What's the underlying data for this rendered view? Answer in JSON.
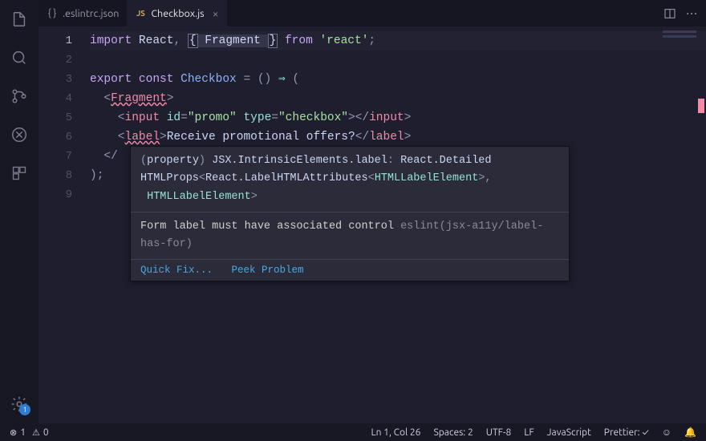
{
  "tabs": [
    {
      "label": ".eslintrc.json",
      "icon": "braces-icon",
      "active": false,
      "dirty": false
    },
    {
      "label": "Checkbox.js",
      "icon": "js-icon",
      "active": true,
      "dirty": false
    }
  ],
  "editor_actions": {
    "split": "split-icon",
    "more": "…"
  },
  "gutter": [
    "1",
    "2",
    "3",
    "4",
    "5",
    "6",
    "7",
    "8",
    "9"
  ],
  "current_line_index": 0,
  "code_lines": [
    [
      {
        "t": "t-key",
        "v": "import",
        "sel": true
      },
      {
        "t": "t-id",
        "v": " React"
      },
      {
        "t": "t-pun",
        "v": ", "
      },
      {
        "t": "t-brk box",
        "v": "{"
      },
      {
        "t": "t-id sel",
        "v": " Fragment "
      },
      {
        "t": "t-brk box",
        "v": "}"
      },
      {
        "t": "t-key",
        "v": " from "
      },
      {
        "t": "t-str",
        "v": "'react'"
      },
      {
        "t": "t-pun",
        "v": ";"
      }
    ],
    [],
    [
      {
        "t": "t-key",
        "v": "export const "
      },
      {
        "t": "t-fn",
        "v": "Checkbox"
      },
      {
        "t": "t-pun",
        "v": " = () "
      },
      {
        "t": "t-arrow",
        "v": "⇒"
      },
      {
        "t": "t-pun",
        "v": " ("
      }
    ],
    [
      {
        "t": "t-pun",
        "v": "  <"
      },
      {
        "t": "t-tag err",
        "v": "Fragment"
      },
      {
        "t": "t-pun",
        "v": ">"
      }
    ],
    [
      {
        "t": "t-pun",
        "v": "    <"
      },
      {
        "t": "t-tag",
        "v": "input"
      },
      {
        "t": "t-att",
        "v": " id"
      },
      {
        "t": "t-pun",
        "v": "="
      },
      {
        "t": "t-str",
        "v": "\"promo\""
      },
      {
        "t": "t-att",
        "v": " type"
      },
      {
        "t": "t-pun",
        "v": "="
      },
      {
        "t": "t-str",
        "v": "\"checkbox\""
      },
      {
        "t": "t-pun",
        "v": "></"
      },
      {
        "t": "t-tag",
        "v": "input"
      },
      {
        "t": "t-pun",
        "v": ">"
      }
    ],
    [
      {
        "t": "t-pun",
        "v": "    <"
      },
      {
        "t": "t-tag err",
        "v": "label"
      },
      {
        "t": "t-pun",
        "v": ">"
      },
      {
        "t": "t-id",
        "v": "Receive promotional offers?"
      },
      {
        "t": "t-pun",
        "v": "</"
      },
      {
        "t": "t-tag",
        "v": "label"
      },
      {
        "t": "t-pun",
        "v": ">"
      }
    ],
    [
      {
        "t": "t-pun",
        "v": "  </"
      }
    ],
    [
      {
        "t": "t-pun",
        "v": ");"
      }
    ],
    []
  ],
  "hover": {
    "sig_tokens": [
      {
        "t": "h-pun",
        "v": "("
      },
      {
        "t": "h-id",
        "v": "property"
      },
      {
        "t": "h-pun",
        "v": ") "
      },
      {
        "t": "h-id",
        "v": "JSX.IntrinsicElements.label"
      },
      {
        "t": "h-pun",
        "v": ": "
      },
      {
        "t": "h-id",
        "v": "React.Detailed\nHTMLProps"
      },
      {
        "t": "h-pun",
        "v": "<"
      },
      {
        "t": "h-id",
        "v": "React.LabelHTMLAttributes"
      },
      {
        "t": "h-pun",
        "v": "<"
      },
      {
        "t": "h-typ",
        "v": "HTMLLabelElement"
      },
      {
        "t": "h-pun",
        "v": ">,\n "
      },
      {
        "t": "h-typ",
        "v": "HTMLLabelElement"
      },
      {
        "t": "h-pun",
        "v": ">"
      }
    ],
    "message": "Form label must have associated control ",
    "message_src": "eslint(jsx-a11y/label-has-for)",
    "links": {
      "fix": "Quick Fix...",
      "peek": "Peek Problem"
    }
  },
  "status": {
    "errors": "1",
    "warnings": "0",
    "cursor": "Ln 1, Col 26",
    "spaces": "Spaces: 2",
    "encoding": "UTF-8",
    "eol": "LF",
    "language": "JavaScript",
    "prettier": "Prettier: ✓",
    "bell": "bell-icon"
  },
  "activity": {
    "settings_badge": "1"
  }
}
